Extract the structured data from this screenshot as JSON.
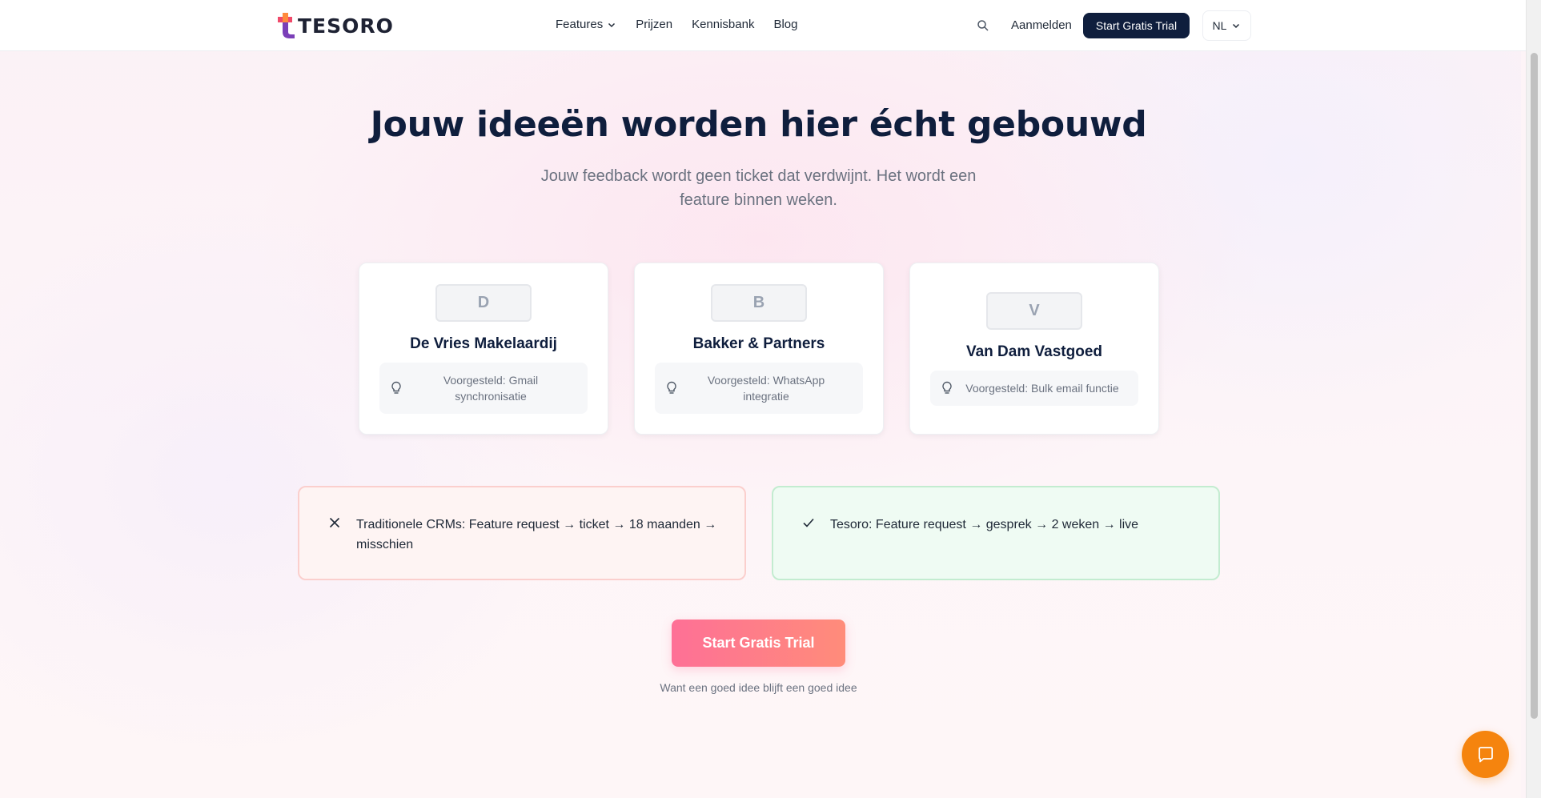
{
  "header": {
    "logo_text": "TESORO",
    "nav": [
      {
        "label": "Features"
      },
      {
        "label": "Prijzen"
      },
      {
        "label": "Kennisbank"
      },
      {
        "label": "Blog"
      }
    ],
    "login_label": "Aanmelden",
    "trial_label": "Start Gratis Trial",
    "language": "NL"
  },
  "hero": {
    "title": "Jouw ideeën worden hier écht gebouwd",
    "subtitle": "Jouw feedback wordt geen ticket dat verdwijnt. Het wordt een feature binnen weken."
  },
  "cards": [
    {
      "initial": "D",
      "name": "De Vries Makelaardij",
      "suggestion": "Voorgesteld: Gmail synchronisatie"
    },
    {
      "initial": "B",
      "name": "Bakker & Partners",
      "suggestion": "Voorgesteld: WhatsApp integratie"
    },
    {
      "initial": "V",
      "name": "Van Dam Vastgoed",
      "suggestion": "Voorgesteld: Bulk email functie"
    }
  ],
  "comparison": {
    "bad": "Traditionele CRMs: Feature request → ticket → 18 maanden → misschien",
    "good": "Tesoro: Feature request → gesprek → 2 weken → live"
  },
  "cta": {
    "label": "Start Gratis Trial",
    "note": "Want een goed idee blijft een goed idee"
  },
  "colors": {
    "navy": "#0f1e3d",
    "cta_gradient_start": "#fe7096",
    "cta_gradient_end": "#ff8c7a",
    "chat_button": "#f5840e"
  },
  "icons": [
    "search-icon",
    "chevron-down-icon",
    "lightbulb-icon",
    "close-icon",
    "check-icon",
    "chat-icon"
  ]
}
